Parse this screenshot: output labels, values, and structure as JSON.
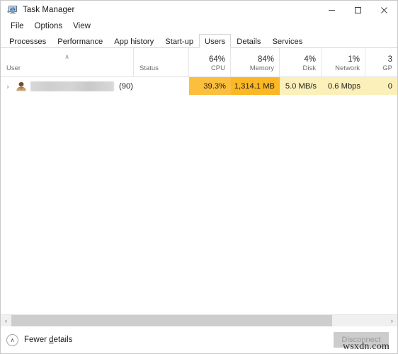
{
  "window": {
    "title": "Task Manager",
    "icon": "task-manager-icon",
    "controls": {
      "minimize": "–",
      "maximize": "☐",
      "close": "✕"
    }
  },
  "menubar": {
    "items": [
      {
        "label": "File"
      },
      {
        "label": "Options"
      },
      {
        "label": "View"
      }
    ]
  },
  "tabs": [
    {
      "label": "Processes",
      "active": false
    },
    {
      "label": "Performance",
      "active": false
    },
    {
      "label": "App history",
      "active": false
    },
    {
      "label": "Start-up",
      "active": false
    },
    {
      "label": "Users",
      "active": true
    },
    {
      "label": "Details",
      "active": false
    },
    {
      "label": "Services",
      "active": false
    }
  ],
  "table": {
    "sort_indicator": "∧",
    "columns": [
      {
        "name": "User",
        "pct": "",
        "label": "User",
        "align": "left"
      },
      {
        "name": "Status",
        "pct": "",
        "label": "Status",
        "align": "left"
      },
      {
        "name": "CPU",
        "pct": "64%",
        "label": "CPU",
        "align": "right"
      },
      {
        "name": "Memory",
        "pct": "84%",
        "label": "Memory",
        "align": "right"
      },
      {
        "name": "Disk",
        "pct": "4%",
        "label": "Disk",
        "align": "right"
      },
      {
        "name": "Network",
        "pct": "1%",
        "label": "Network",
        "align": "right"
      },
      {
        "name": "GPU",
        "pct": "3",
        "label": "GP",
        "align": "right"
      }
    ],
    "rows": [
      {
        "expander": "›",
        "icon": "user-icon",
        "user": "",
        "count": "(90)",
        "status": "",
        "cpu": "39.3%",
        "memory": "1,314.1 MB",
        "disk": "5.0 MB/s",
        "network": "0.6 Mbps",
        "gpu": "0"
      }
    ]
  },
  "scrollbar": {
    "left_arrow": "‹",
    "right_arrow": "›"
  },
  "footer": {
    "fewer_details_icon": "∧",
    "fewer_details_pre": "Fewer ",
    "fewer_details_accel": "d",
    "fewer_details_post": "etails",
    "disconnect_label": "Disconnect",
    "watermark": "wsxdn.com"
  },
  "colors": {
    "cpu_cell": "#fcbf3d",
    "memory_cell": "#fcb724",
    "disk_cell": "#fbf0b9",
    "network_cell": "#fbf0b9",
    "gpu_cell": "#fbf0b9",
    "header_underline": "#e8a500",
    "accent": "#0078d7"
  }
}
